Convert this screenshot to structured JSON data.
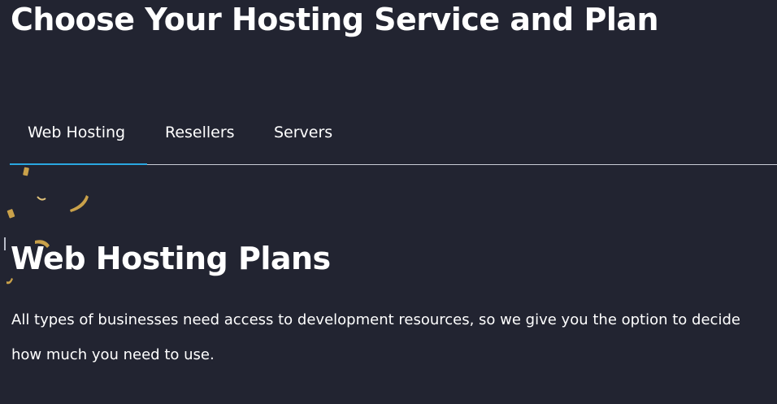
{
  "page": {
    "title": "Choose Your Hosting Service and Plan"
  },
  "tabs": [
    {
      "label": "Web Hosting",
      "active": true
    },
    {
      "label": "Resellers",
      "active": false
    },
    {
      "label": "Servers",
      "active": false
    }
  ],
  "section": {
    "title": "Web Hosting Plans",
    "description": "All types of businesses need access to development resources, so we give you the option to decide how much you need to use."
  },
  "colors": {
    "background": "#222431",
    "accent": "#2aa7e0",
    "text": "#ffffff",
    "confetti": "#c9a14a"
  },
  "decor": {
    "confetti": "confetti-decoration"
  }
}
